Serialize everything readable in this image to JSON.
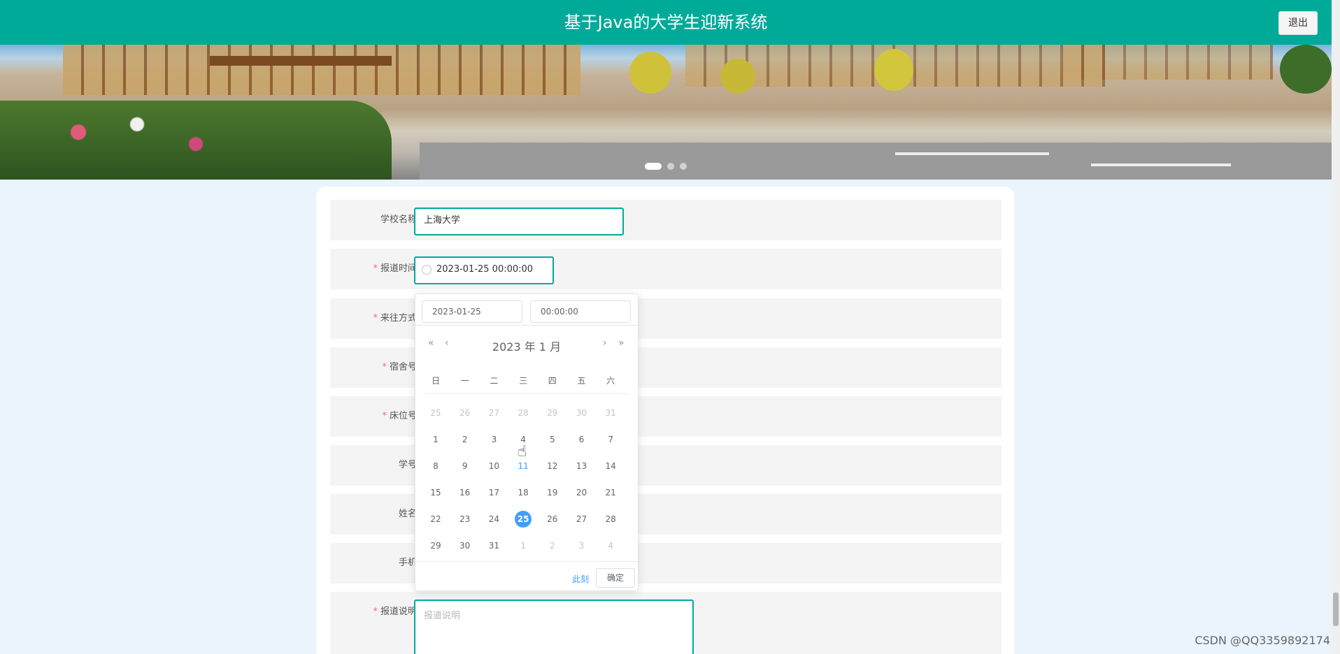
{
  "header": {
    "title": "基于Java的大学生迎新系统",
    "logout_label": "退出"
  },
  "banner": {
    "slides": 3,
    "active_slide": 1
  },
  "form": {
    "school": {
      "label": "学校名称",
      "value": "上海大学"
    },
    "report_time": {
      "label": "报道时间",
      "value": "2023-01-25 00:00:00",
      "required": true
    },
    "transport": {
      "label": "来往方式",
      "required": true
    },
    "dorm": {
      "label": "宿舍号",
      "required": true
    },
    "bed": {
      "label": "床位号",
      "required": true
    },
    "student_id": {
      "label": "学号"
    },
    "name": {
      "label": "姓名"
    },
    "phone": {
      "label": "手机"
    },
    "report_note": {
      "label": "报道说明",
      "placeholder": "报道说明",
      "required": true
    }
  },
  "picker": {
    "date_input": "2023-01-25",
    "time_input": "00:00:00",
    "year_month": "2023 年  1 月",
    "nav": {
      "prev_year": "«",
      "prev_month": "‹",
      "next_month": "›",
      "next_year": "»"
    },
    "weekdays": [
      "日",
      "一",
      "二",
      "三",
      "四",
      "五",
      "六"
    ],
    "weeks": [
      [
        "25",
        "26",
        "27",
        "28",
        "29",
        "30",
        "31"
      ],
      [
        "1",
        "2",
        "3",
        "4",
        "5",
        "6",
        "7"
      ],
      [
        "8",
        "9",
        "10",
        "11",
        "12",
        "13",
        "14"
      ],
      [
        "15",
        "16",
        "17",
        "18",
        "19",
        "20",
        "21"
      ],
      [
        "22",
        "23",
        "24",
        "25",
        "26",
        "27",
        "28"
      ],
      [
        "29",
        "30",
        "31",
        "1",
        "2",
        "3",
        "4"
      ]
    ],
    "selected": "25",
    "today": "11",
    "now_label": "此刻",
    "confirm_label": "确定"
  },
  "watermark": "CSDN @QQ3359892174",
  "colors": {
    "header": "#00aa99",
    "accent": "#00aa99",
    "selected_day": "#409eff",
    "required_star": "#f56c6c"
  }
}
